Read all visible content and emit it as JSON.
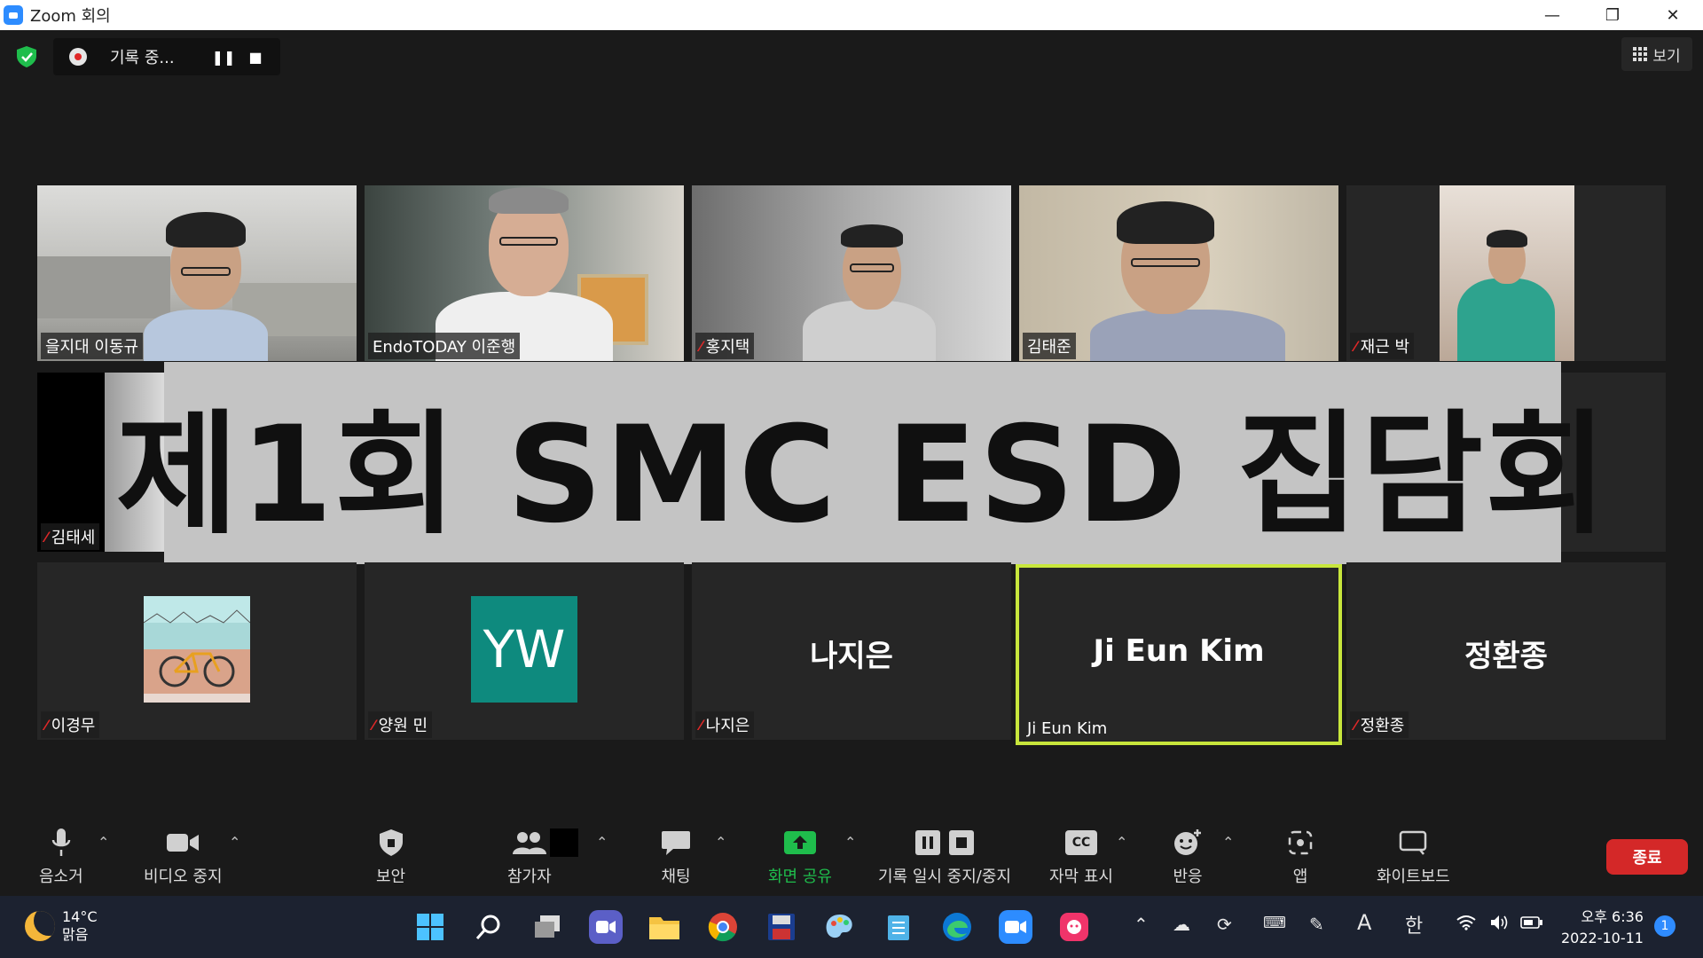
{
  "window": {
    "title": "Zoom 회의",
    "minimize": "—",
    "restore": "❐",
    "close": "✕"
  },
  "recording": {
    "status": "기록 중...",
    "pause_icon": "❚❚",
    "stop_icon": "■"
  },
  "view_button": {
    "label": "보기",
    "icon": "grid-icon"
  },
  "participants": [
    {
      "name": "을지대 이동규",
      "muted": false
    },
    {
      "name": "EndoTODAY 이준행",
      "muted": false
    },
    {
      "name": "홍지택",
      "muted": true
    },
    {
      "name": "김태준",
      "muted": false
    },
    {
      "name": "재근 박",
      "muted": true
    },
    {
      "name": "김태세",
      "muted": true
    },
    {
      "name": "이경무",
      "muted": true
    },
    {
      "name": "양원 민",
      "muted": true,
      "avatar": "YW"
    },
    {
      "name": "나지은",
      "muted": true,
      "display": "나지은"
    },
    {
      "name": "Ji Eun Kim",
      "muted": false,
      "display": "Ji Eun Kim",
      "active_speaker": true
    },
    {
      "name": "정환종",
      "muted": true,
      "display": "정환종"
    }
  ],
  "banner": {
    "text": "제1회 SMC ESD 집담회"
  },
  "toolbar": {
    "mute": "음소거",
    "video": "비디오 중지",
    "security": "보안",
    "participants": "참가자",
    "chat": "채팅",
    "share": "화면 공유",
    "record": "기록 일시 중지/중지",
    "captions": "자막 표시",
    "cc_icon": "CC",
    "reactions": "반응",
    "apps": "앱",
    "whiteboard": "화이트보드",
    "end": "종료"
  },
  "taskbar": {
    "temperature": "14°C",
    "weather": "맑음",
    "ime_a": "A",
    "ime_han": "한",
    "time": "오후 6:36",
    "date": "2022-10-11",
    "notifications": "1"
  },
  "colors": {
    "background": "#1a1a1a",
    "end_button": "#d42828",
    "share_green": "#1fbd4c",
    "active_border": "#c8e63c",
    "avatar_teal": "#0e8a7e"
  }
}
